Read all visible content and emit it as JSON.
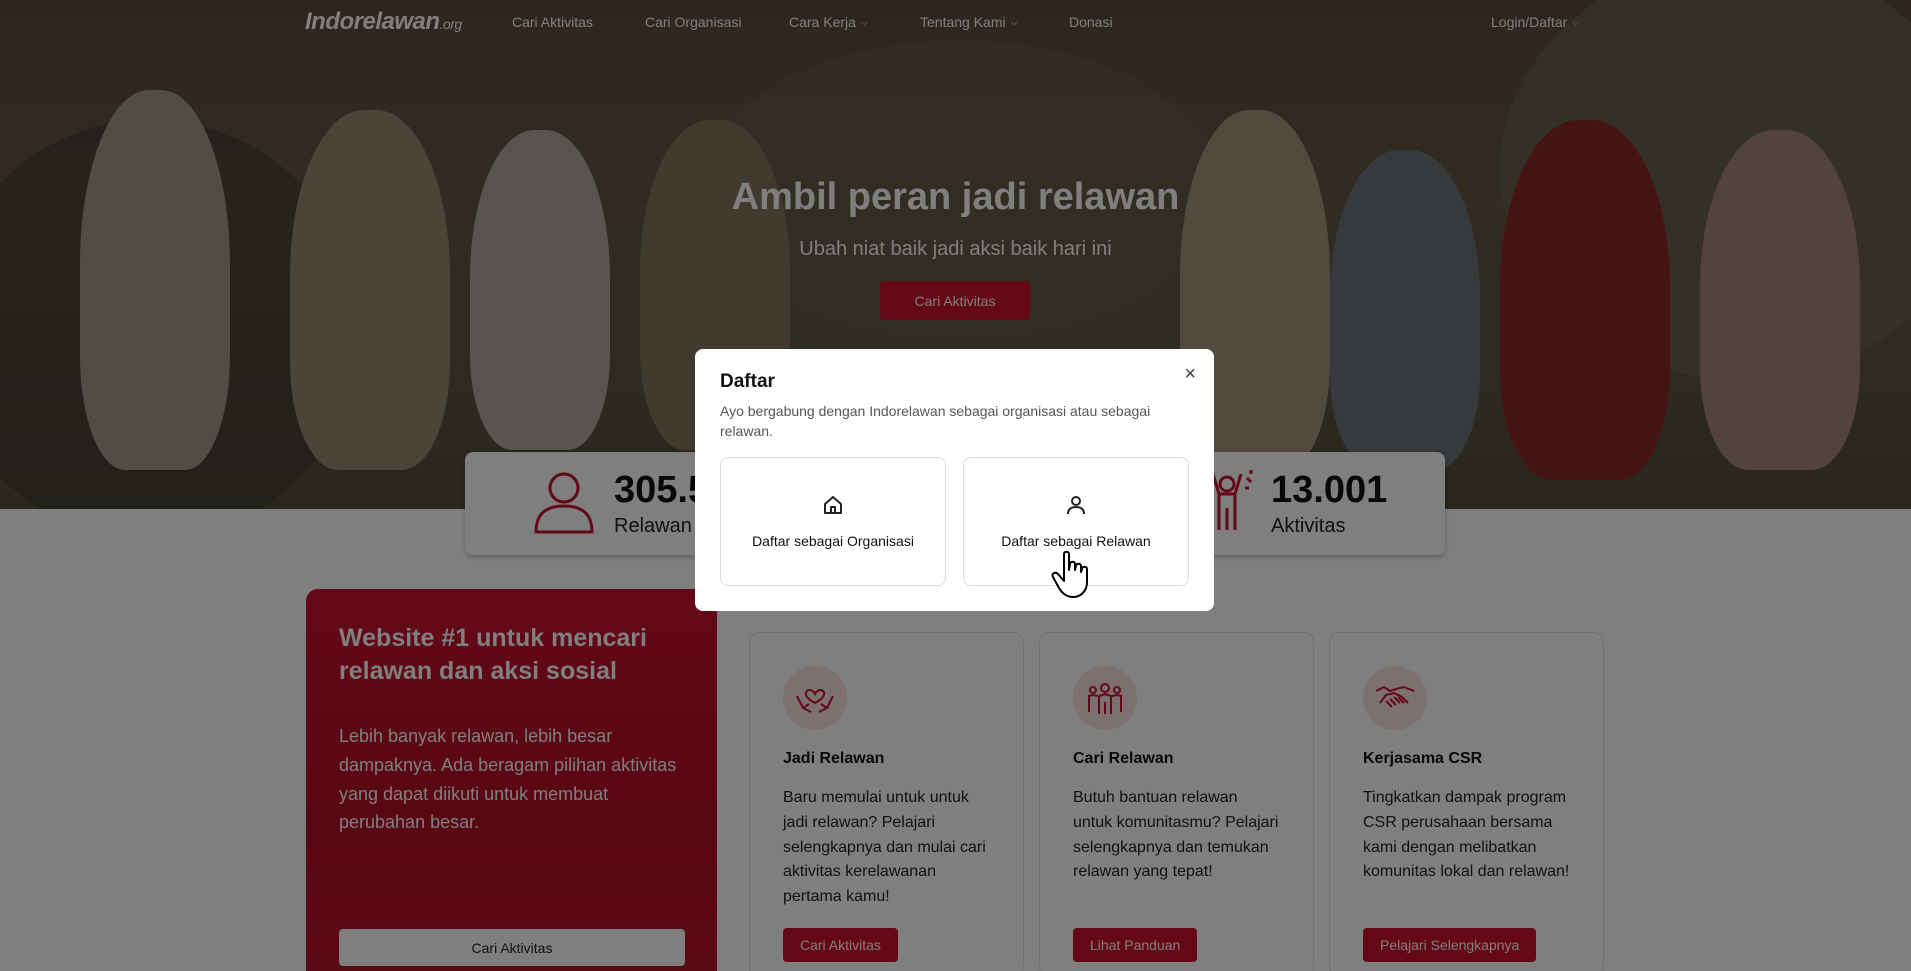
{
  "nav": {
    "logo_main": "Indorelawan",
    "logo_suffix": ".org",
    "items": [
      {
        "label": "Cari Aktivitas"
      },
      {
        "label": "Cari Organisasi"
      },
      {
        "label": "Cara Kerja"
      },
      {
        "label": "Tentang Kami"
      },
      {
        "label": "Donasi"
      }
    ],
    "login_label": "Login/Daftar"
  },
  "hero": {
    "title": "Ambil peran jadi relawan",
    "subtitle": "Ubah niat baik jadi aksi baik hari ini",
    "button_label": "Cari Aktivitas"
  },
  "stats": [
    {
      "value": "305.5",
      "label": "Relawan",
      "icon": "person-icon"
    },
    {
      "value": "13.001",
      "label": "Aktivitas",
      "icon": "cheering-person-icon"
    }
  ],
  "promo": {
    "title": "Website #1 untuk mencari relawan dan aksi sosial",
    "description": "Lebih banyak relawan, lebih besar dampaknya. Ada beragam pilihan aktivitas yang dapat diikuti untuk membuat perubahan besar.",
    "button_label": "Cari Aktivitas"
  },
  "cards": [
    {
      "title": "Jadi Relawan",
      "description": "Baru memulai untuk untuk jadi relawan? Pelajari selengkapnya dan mulai cari aktivitas kerelawanan pertama kamu!",
      "button_label": "Cari Aktivitas",
      "icon": "hands-heart-icon"
    },
    {
      "title": "Cari Relawan",
      "description": "Butuh bantuan relawan untuk komunitasmu? Pelajari selengkapnya dan temukan relawan yang tepat!",
      "button_label": "Lihat Panduan",
      "icon": "people-group-icon"
    },
    {
      "title": "Kerjasama CSR",
      "description": "Tingkatkan dampak program CSR perusahaan bersama kami dengan melibatkan komunitas lokal dan relawan!",
      "button_label": "Pelajari Selengkapnya",
      "icon": "handshake-icon"
    }
  ],
  "modal": {
    "title": "Daftar",
    "description": "Ayo bergabung dengan Indorelawan sebagai organisasi atau sebagai relawan.",
    "close_label": "×",
    "options": [
      {
        "label": "Daftar sebagai Organisasi",
        "icon": "home-icon"
      },
      {
        "label": "Daftar sebagai Relawan",
        "icon": "user-icon"
      }
    ]
  },
  "colors": {
    "brand_red": "#c8102e",
    "overlay": "rgba(0,0,0,0.5)"
  }
}
